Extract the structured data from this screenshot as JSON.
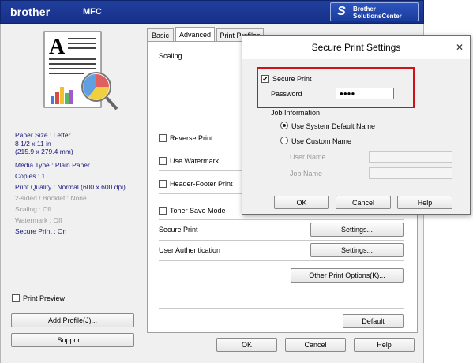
{
  "titlebar": {
    "brand": "brother",
    "model": "MFC",
    "solutions_line1": "Brother",
    "solutions_line2": "SolutionsCenter"
  },
  "left": {
    "info": [
      "Paper Size : Letter",
      "8 1/2 x 11 in",
      "(215.9 x 279.4 mm)",
      "Media Type : Plain Paper",
      "Copies : 1",
      "Print Quality : Normal (600 x 600 dpi)",
      "2-sided / Booklet : None",
      "Scaling : Off",
      "Watermark : Off",
      "Secure Print : On"
    ],
    "print_preview_label": "Print Preview",
    "add_profile_label": "Add Profile(J)...",
    "support_label": "Support..."
  },
  "tabs": [
    "Basic",
    "Advanced",
    "Print Profiles"
  ],
  "advanced": {
    "scaling_label": "Scaling",
    "reverse_print": "Reverse Print",
    "use_watermark": "Use Watermark",
    "header_footer": "Header-Footer Print",
    "toner_save": "Toner Save Mode",
    "secure_print_label": "Secure Print",
    "secure_print_settings": "Settings...",
    "user_auth_label": "User Authentication",
    "user_auth_settings": "Settings...",
    "other_options": "Other Print Options(K)...",
    "default_label": "Default"
  },
  "footer": {
    "ok": "OK",
    "cancel": "Cancel",
    "help": "Help"
  },
  "secure_dialog": {
    "title": "Secure Print Settings",
    "close": "✕",
    "secure_print_checkbox": "Secure Print",
    "secure_print_checked": true,
    "password_label": "Password",
    "password_value": "●●●●",
    "job_info_label": "Job Information",
    "use_system_default": "Use System Default Name",
    "use_custom_name": "Use Custom Name",
    "selected_option": "Use System Default Name",
    "user_name_label": "User Name",
    "job_name_label": "Job Name",
    "ok": "OK",
    "cancel": "Cancel",
    "help": "Help"
  },
  "colors": {
    "titlebar": "#1f3f9c",
    "highlight": "#d1111a",
    "info_text": "#1a1a80"
  }
}
